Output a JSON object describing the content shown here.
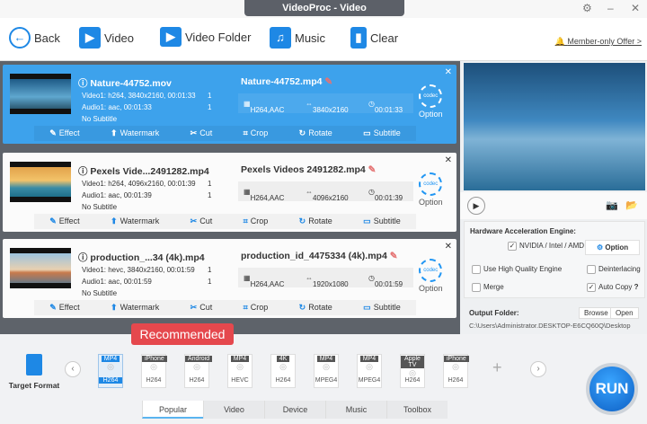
{
  "window": {
    "title": "VideoProc - Video"
  },
  "toolbar": {
    "back": "Back",
    "video": "Video",
    "video_folder": "Video Folder",
    "music": "Music",
    "clear": "Clear",
    "offer": "Member-only Offer >"
  },
  "videos": [
    {
      "source": "Nature-44752.mov",
      "video_track": "Video1: h264, 3840x2160, 00:01:33",
      "audio_track": "Audio1: aac, 00:01:33",
      "subtitle": "No Subtitle",
      "output": "Nature-44752.mp4",
      "codec": "H264,AAC",
      "resolution": "3840x2160",
      "duration": "00:01:33",
      "selected": true
    },
    {
      "source": "Pexels Vide...2491282.mp4",
      "video_track": "Video1: h264, 4096x2160, 00:01:39",
      "audio_track": "Audio1: aac, 00:01:39",
      "subtitle": "No Subtitle",
      "output": "Pexels Videos 2491282.mp4",
      "codec": "H264,AAC",
      "resolution": "4096x2160",
      "duration": "00:01:39",
      "selected": false
    },
    {
      "source": "production_...34 (4k).mp4",
      "video_track": "Video1: hevc, 3840x2160, 00:01:59",
      "audio_track": "Audio1: aac, 00:01:59",
      "subtitle": "No Subtitle",
      "output": "production_id_4475334 (4k).mp4",
      "codec": "H264,AAC",
      "resolution": "1920x1080",
      "duration": "00:01:59",
      "selected": false
    }
  ],
  "card_labels": {
    "option": "Option",
    "codec": "codec",
    "track_count": "1",
    "edit": [
      "Effect",
      "Watermark",
      "Cut",
      "Crop",
      "Rotate",
      "Subtitle"
    ]
  },
  "settings": {
    "hw_title": "Hardware Acceleration Engine:",
    "hw_option": "NVIDIA / Intel / AMD",
    "hw_checked": true,
    "option_button": "Option",
    "high_quality": "Use High Quality Engine",
    "high_quality_checked": false,
    "deinterlacing": "Deinterlacing",
    "deinterlacing_checked": false,
    "merge": "Merge",
    "merge_checked": false,
    "auto_copy": "Auto Copy",
    "auto_copy_checked": true,
    "help": "?",
    "output_folder_label": "Output Folder:",
    "browse": "Browse",
    "open": "Open",
    "output_path": "C:\\Users\\Administrator.DESKTOP-E6CQ60Q\\Desktop"
  },
  "bottom": {
    "target_format": "Target Format",
    "recommended": "Recommended",
    "run": "RUN",
    "plus": "+",
    "formats": [
      {
        "tag": "MP4",
        "codec": "H264"
      },
      {
        "tag": "iPhone",
        "codec": "H264"
      },
      {
        "tag": "Android",
        "codec": "H264"
      },
      {
        "tag": "MP4",
        "codec": "HEVC"
      },
      {
        "tag": "4K",
        "codec": "H264"
      },
      {
        "tag": "MP4",
        "codec": "MPEG4"
      },
      {
        "tag": "MP4",
        "codec": "MPEG4"
      },
      {
        "tag": "Apple TV",
        "codec": "H264"
      },
      {
        "tag": "iPhone",
        "codec": "H264"
      }
    ],
    "tabs": [
      "Popular",
      "Video",
      "Device",
      "Music",
      "Toolbox"
    ]
  }
}
